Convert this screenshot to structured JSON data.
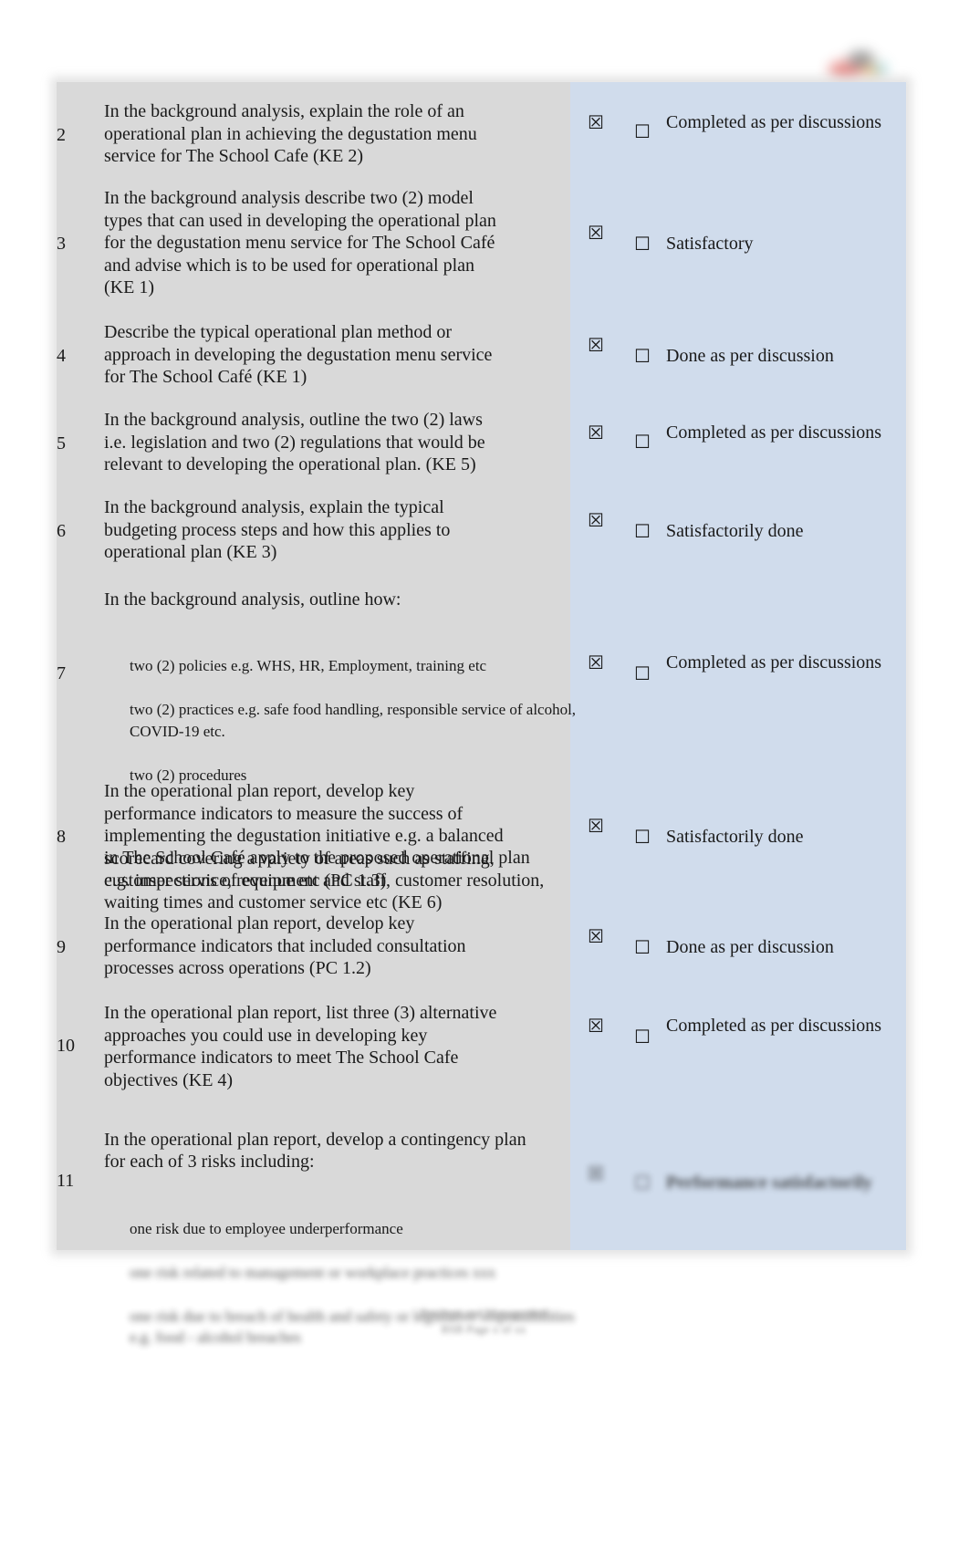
{
  "document": {
    "logo_icon": "organisation-logo",
    "rows": [
      {
        "number": "2",
        "question": "In the background analysis, explain the role of an\noperational plan in achieving the degustation menu\nservice for The School Cafe (KE 2)",
        "satisfactory_mark": "☒",
        "not_satisfactory_mark": "☐",
        "comment": "Completed as per discussions"
      },
      {
        "number": "3",
        "question": "In the background analysis describe two (2) model\ntypes that can used in developing the operational plan\nfor the degustation menu service for The School Café\nand advise which is to be used for operational plan\n(KE 1)",
        "satisfactory_mark": "☒",
        "not_satisfactory_mark": "☐",
        "comment": "Satisfactory"
      },
      {
        "number": "4",
        "question": "Describe the typical operational plan method or\napproach in developing the degustation menu service\nfor The School Café (KE 1)",
        "satisfactory_mark": "☒",
        "not_satisfactory_mark": "☐",
        "comment": "Done as per discussion"
      },
      {
        "number": "5",
        "question": "In the background analysis, outline the two (2) laws\ni.e. legislation and two (2) regulations that would be\nrelevant to developing the operational plan. (KE 5)",
        "satisfactory_mark": "☒",
        "not_satisfactory_mark": "☐",
        "comment": "Completed as per discussions"
      },
      {
        "number": "6",
        "question": "In the background analysis, explain the typical\nbudgeting process steps and how this applies to\noperational plan (KE 3)",
        "satisfactory_mark": "☒",
        "not_satisfactory_mark": "☐",
        "comment": "Satisfactorily done"
      },
      {
        "number": "7",
        "intro": "In the background analysis, outline how:",
        "bullets": [
          "two (2) policies e.g. WHS, HR, Employment, training etc",
          "two (2) practices e.g. safe food handling, responsible service of alcohol, COVID-19 etc.",
          "two (2) procedures"
        ],
        "outro": "in The School Café apply to the proposed operational plan\ne.g. inspections of equipment and staff, customer resolution,\nwaiting times and customer service etc (KE 6)",
        "satisfactory_mark": "☒",
        "not_satisfactory_mark": "☐",
        "comment": "Completed as per discussions"
      },
      {
        "number": "8",
        "question": "In the operational plan report, develop key\nperformance indicators to measure the success of\nimplementing the degustation initiative e.g. a balanced\nscorecard covering a variety of areas such as staffing,\ncustomer service, revenue etc (PC 1.3)",
        "satisfactory_mark": "☒",
        "not_satisfactory_mark": "☐",
        "comment": "Satisfactorily done"
      },
      {
        "number": "9",
        "question": "In the operational plan report, develop key\nperformance indicators that included consultation\nprocesses across operations (PC 1.2)",
        "satisfactory_mark": "☒",
        "not_satisfactory_mark": "☐",
        "comment": "Done as per discussion"
      },
      {
        "number": "10",
        "question": "In the operational plan report, list three (3) alternative\napproaches you could use in developing key\nperformance indicators to meet The School Cafe\nobjectives (KE 4)",
        "satisfactory_mark": "☒",
        "not_satisfactory_mark": "☐",
        "comment": "Completed as per discussions"
      },
      {
        "number": "11",
        "intro": "In the operational plan report, develop a contingency plan\nfor each of 3 risks including:",
        "bullets": [
          "one risk due to employee underperformance",
          "one risk related to management or workplace practices xxx",
          "one risk due to breach of health and safety or legislative responsibilities e.g. food - alcohol breaches"
        ],
        "satisfactory_mark": "☒",
        "not_satisfactory_mark": "☐",
        "comment": "Performance satisfactorily"
      }
    ],
    "bullet_glyph": "",
    "footer": {
      "line1": "Business and Management",
      "line2": "BSB Page x of xx"
    }
  }
}
